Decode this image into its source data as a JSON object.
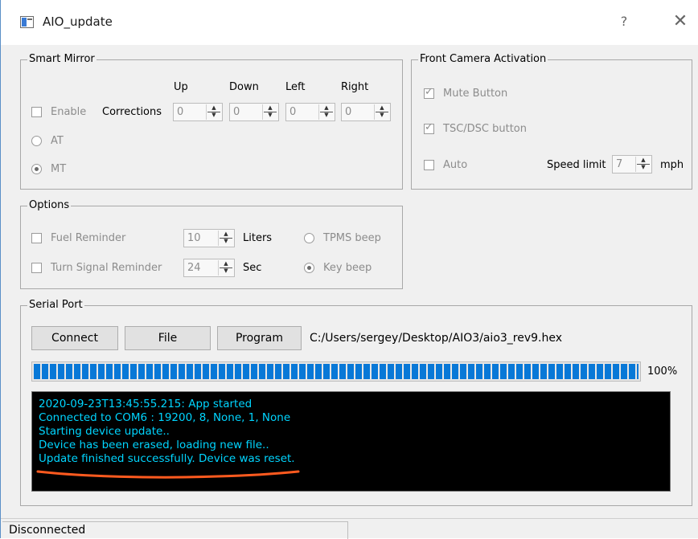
{
  "window": {
    "title": "AIO_update",
    "help": "?",
    "close": "✕"
  },
  "smart_mirror": {
    "title": "Smart Mirror",
    "enable_label": "Enable",
    "corrections_label": "Corrections",
    "up_label": "Up",
    "down_label": "Down",
    "left_label": "Left",
    "right_label": "Right",
    "up_value": "0",
    "down_value": "0",
    "left_value": "0",
    "right_value": "0",
    "at_label": "AT",
    "mt_label": "MT",
    "enable_checked": false,
    "selected_mode": "MT"
  },
  "front_camera": {
    "title": "Front Camera Activation",
    "mute_label": "Mute Button",
    "mute_checked": true,
    "tsc_label": "TSC/DSC button",
    "tsc_checked": true,
    "auto_label": "Auto",
    "auto_checked": false,
    "speed_limit_label": "Speed limit",
    "speed_limit_value": "7",
    "speed_unit": "mph"
  },
  "options": {
    "title": "Options",
    "fuel_label": "Fuel Reminder",
    "fuel_value": "10",
    "fuel_unit": "Liters",
    "turn_label": "Turn Signal Reminder",
    "turn_value": "24",
    "turn_unit": "Sec",
    "tpms_label": "TPMS beep",
    "key_label": "Key beep",
    "selected_beep": "Key beep"
  },
  "serial_port": {
    "title": "Serial Port",
    "connect_label": "Connect",
    "file_label": "File",
    "program_label": "Program",
    "file_path": "C:/Users/sergey/Desktop/AIO3/aio3_rev9.hex",
    "progress_percent": 100,
    "progress_text": "100%",
    "log": [
      "2020-09-23T13:45:55.215: App started",
      "Connected to COM6 : 19200, 8, None, 1, None",
      "Starting device update..",
      "Device has been erased, loading new file..",
      "Update finished successfully. Device was reset."
    ]
  },
  "status": {
    "text": "Disconnected"
  },
  "colors": {
    "progress": "#0878d7",
    "console_bg": "#000000",
    "console_text": "#00d5ff",
    "annotation": "#ff5a1f"
  }
}
